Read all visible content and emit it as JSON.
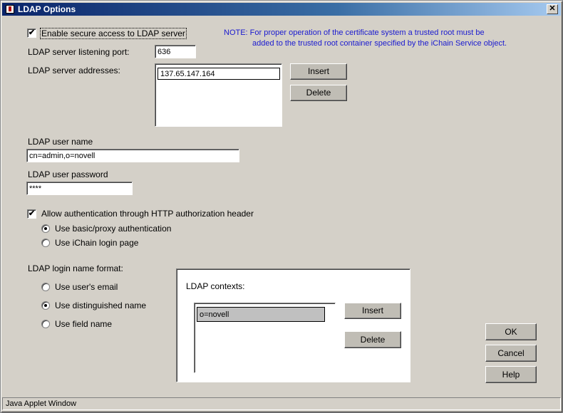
{
  "window": {
    "title": "LDAP Options",
    "close_label": "✕"
  },
  "secure": {
    "checked": true,
    "label": "Enable secure access to LDAP server"
  },
  "note": {
    "line1": "NOTE: For proper operation of the certificate system a trusted root must be",
    "line2": "added to the trusted root container specified by the iChain Service object."
  },
  "port": {
    "label": "LDAP server listening port:",
    "value": "636"
  },
  "addresses": {
    "label": "LDAP server addresses:",
    "items": [
      "137.65.147.164"
    ],
    "insert_label": "Insert",
    "delete_label": "Delete"
  },
  "username": {
    "label": "LDAP user name",
    "value": "cn=admin,o=novell"
  },
  "password": {
    "label": "LDAP user password",
    "value": "****"
  },
  "http_auth": {
    "checked": true,
    "label": "Allow authentication through HTTP authorization header",
    "options": [
      {
        "label": "Use basic/proxy authentication",
        "selected": true
      },
      {
        "label": "Use iChain login page",
        "selected": false
      }
    ]
  },
  "login_format": {
    "label": "LDAP login name format:",
    "options": [
      {
        "label": "Use user's email",
        "selected": false
      },
      {
        "label": "Use distinguished name",
        "selected": true
      },
      {
        "label": "Use field name",
        "selected": false
      }
    ]
  },
  "contexts": {
    "label": "LDAP contexts:",
    "items": [
      "o=novell"
    ],
    "insert_label": "Insert",
    "delete_label": "Delete"
  },
  "dialog_buttons": {
    "ok": "OK",
    "cancel": "Cancel",
    "help": "Help"
  },
  "status_bar": {
    "text": "Java Applet Window"
  },
  "icons": {
    "window_icon": "applet-icon",
    "close_icon": "close-icon",
    "check_mark": "✔"
  }
}
